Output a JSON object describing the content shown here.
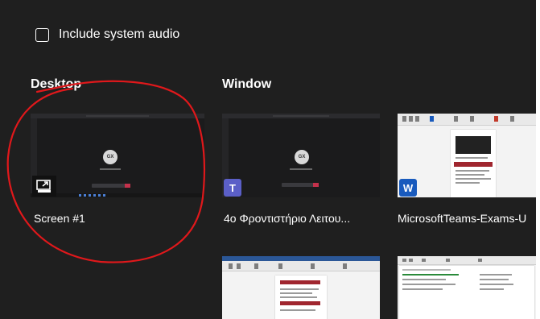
{
  "audio": {
    "label": "Include system audio",
    "checked": false
  },
  "sections": {
    "desktop": "Desktop",
    "window": "Window"
  },
  "desktop_items": [
    {
      "caption": "Screen #1",
      "icon": "share-screen-icon",
      "avatar_initials": "GX"
    }
  ],
  "window_items": [
    {
      "caption": "4ο Φροντιστήριο Λειτου...",
      "app_icon": "teams-icon",
      "app_letter": "T",
      "avatar_initials": "GX",
      "accent": "#5b5fc7"
    },
    {
      "caption": "MicrosoftTeams-Exams-U",
      "app_icon": "word-icon",
      "app_letter": "W",
      "accent": "#185abd"
    },
    {
      "caption": "",
      "app_icon": "word-icon"
    },
    {
      "caption": "",
      "app_icon": "excel-icon"
    }
  ],
  "colors": {
    "panel": "#1f1f1f",
    "annotation": "#e0181b"
  }
}
